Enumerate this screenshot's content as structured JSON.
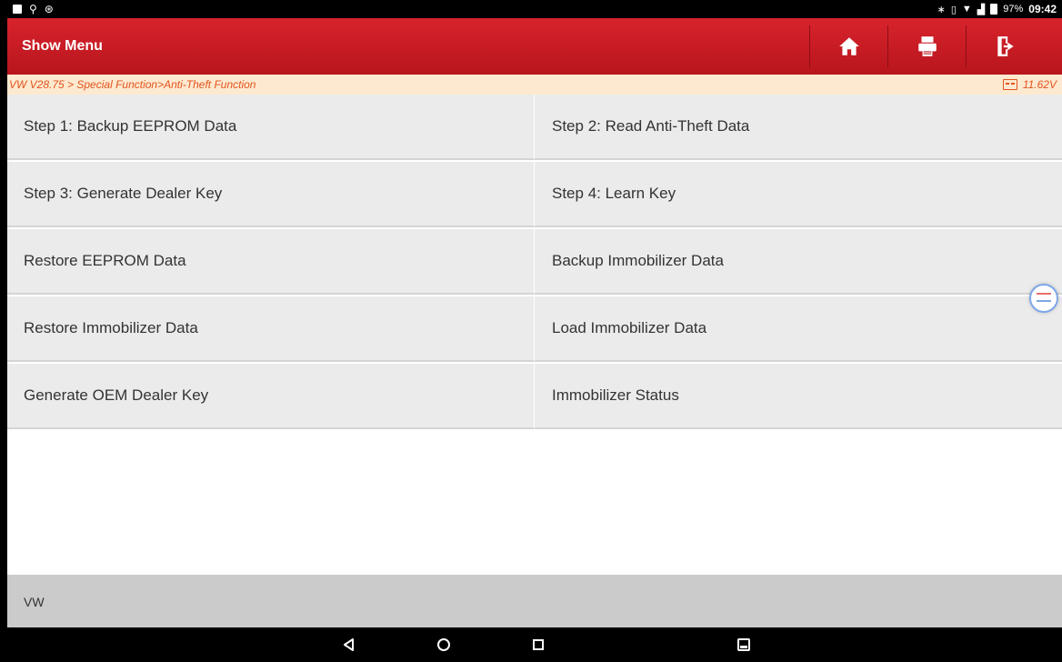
{
  "statusbar": {
    "left_icons": [
      "image-icon",
      "usb-icon",
      "settings-icon"
    ],
    "battery_percent": "97%",
    "time": "09:42"
  },
  "header": {
    "title": "Show Menu",
    "buttons": [
      {
        "name": "home-button",
        "icon": "home-icon"
      },
      {
        "name": "print-button",
        "icon": "print-icon"
      },
      {
        "name": "exit-button",
        "icon": "exit-icon"
      }
    ],
    "color": "#c81a22"
  },
  "breadcrumb": {
    "path": "VW V28.75 > Special Function>Anti-Theft Function",
    "voltage": "11.62V",
    "color": "#e2531f"
  },
  "menu": {
    "items": [
      "Step 1: Backup EEPROM Data",
      "Step 2: Read Anti-Theft Data",
      "Step 3: Generate Dealer Key",
      "Step 4: Learn Key",
      "Restore EEPROM Data",
      "Backup Immobilizer Data",
      "Restore Immobilizer Data",
      "Load Immobilizer Data",
      "Generate OEM Dealer Key",
      "Immobilizer Status"
    ]
  },
  "footer": {
    "label": "VW"
  },
  "navbar": {
    "buttons": [
      "back-icon",
      "home-circle-icon",
      "recents-icon",
      "screenshot-icon"
    ]
  }
}
